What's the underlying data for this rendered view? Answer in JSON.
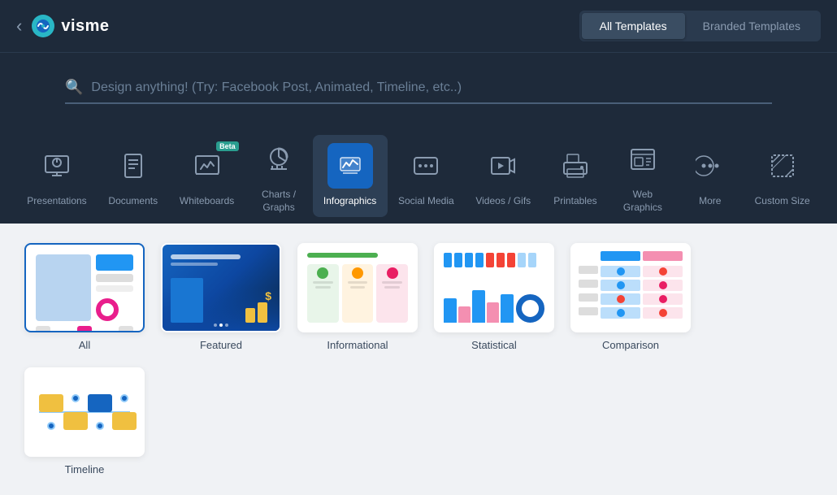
{
  "header": {
    "back_label": "‹",
    "logo_text": "visme",
    "tabs": [
      {
        "id": "all",
        "label": "All Templates",
        "active": true
      },
      {
        "id": "branded",
        "label": "Branded Templates",
        "active": false
      }
    ]
  },
  "search": {
    "placeholder": "Design anything! (Try: Facebook Post, Animated, Timeline, etc..)"
  },
  "categories": [
    {
      "id": "presentations",
      "label": "Presentations",
      "active": false,
      "beta": false
    },
    {
      "id": "documents",
      "label": "Documents",
      "active": false,
      "beta": false
    },
    {
      "id": "whiteboards",
      "label": "Whiteboards",
      "active": false,
      "beta": true
    },
    {
      "id": "charts-graphs",
      "label": "Charts / Graphs",
      "active": false,
      "beta": false
    },
    {
      "id": "infographics",
      "label": "Infographics",
      "active": true,
      "beta": false
    },
    {
      "id": "social-media",
      "label": "Social Media",
      "active": false,
      "beta": false
    },
    {
      "id": "videos-gifs",
      "label": "Videos / Gifs",
      "active": false,
      "beta": false
    },
    {
      "id": "printables",
      "label": "Printables",
      "active": false,
      "beta": false
    },
    {
      "id": "web-graphics",
      "label": "Web Graphics",
      "active": false,
      "beta": false
    },
    {
      "id": "more",
      "label": "More",
      "active": false,
      "beta": false
    },
    {
      "id": "custom-size",
      "label": "Custom Size",
      "active": false,
      "beta": false
    }
  ],
  "subcategories": [
    {
      "id": "all",
      "label": "All",
      "selected": true
    },
    {
      "id": "featured",
      "label": "Featured",
      "selected": false
    },
    {
      "id": "informational",
      "label": "Informational",
      "selected": false
    },
    {
      "id": "statistical",
      "label": "Statistical",
      "selected": false
    },
    {
      "id": "comparison",
      "label": "Comparison",
      "selected": false
    },
    {
      "id": "timeline",
      "label": "Timeline",
      "selected": false
    }
  ],
  "colors": {
    "active_tab_bg": "#3a4d62",
    "active_cat_bg": "#1565c0",
    "brand_blue": "#2196f3"
  }
}
